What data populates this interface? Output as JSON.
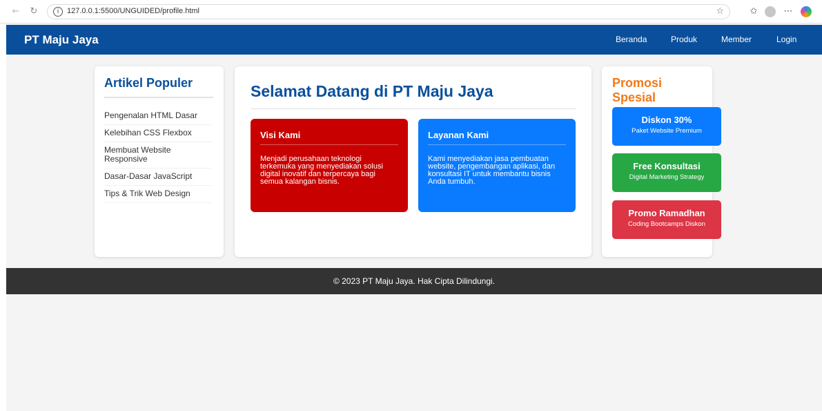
{
  "browser": {
    "url": "127.0.0.1:5500/UNGUIDED/profile.html",
    "icons": [
      "back-icon",
      "reload-icon",
      "info-icon",
      "star-icon",
      "favorites-icon",
      "profile-icon",
      "more-icon",
      "copilot-icon"
    ]
  },
  "header": {
    "brand": "PT Maju Jaya",
    "menu": [
      "Beranda",
      "Produk",
      "Member",
      "Login"
    ]
  },
  "sidebar": {
    "title": "Artikel Populer",
    "articles": [
      "Pengenalan HTML Dasar",
      "Kelebihan CSS Flexbox",
      "Membuat Website Responsive",
      "Dasar-Dasar JavaScript",
      "Tips & Trik Web Design"
    ]
  },
  "main": {
    "title": "Selamat Datang di PT Maju Jaya",
    "boxes": [
      {
        "title": "Visi Kami",
        "text": "Menjadi perusahaan teknologi terkemuka yang menyediakan solusi digital inovatif dan terpercaya bagi semua kalangan bisnis.",
        "color": "#c80000"
      },
      {
        "title": "Layanan Kami",
        "text": "Kami menyediakan jasa pembuatan website, pengembangan aplikasi, dan konsultasi IT untuk membantu bisnis Anda tumbuh.",
        "color": "#0a7bff"
      }
    ]
  },
  "promos": {
    "title": "Promosi Spesial",
    "items": [
      {
        "title": "Diskon 30%",
        "subtitle": "Paket Website Premium",
        "color": "#0a7bff"
      },
      {
        "title": "Free Konsultasi",
        "subtitle": "Digital Marketing Strategy",
        "color": "#28a745"
      },
      {
        "title": "Promo Ramadhan",
        "subtitle": "Coding Bootcamps Diskon",
        "color": "#dc3545"
      }
    ]
  },
  "footer": {
    "text": "© 2023 PT Maju Jaya. Hak Cipta Dilindungi."
  },
  "colors": {
    "header_bg": "#0a4f9c",
    "promo_title": "#f07a1a",
    "footer_bg": "#333333"
  }
}
